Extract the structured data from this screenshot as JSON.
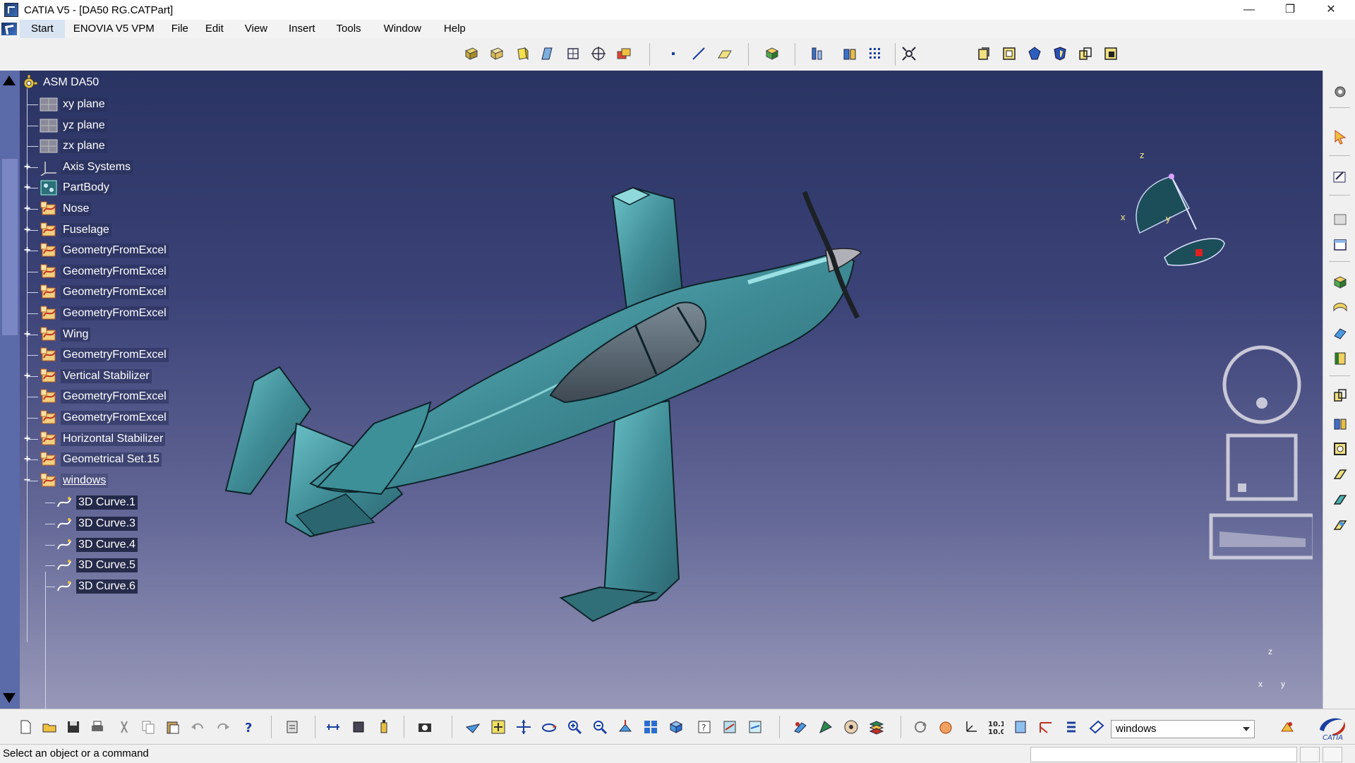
{
  "window": {
    "title": "CATIA V5 - [DA50 RG.CATPart]",
    "controls": [
      "—",
      "❐",
      "✕"
    ]
  },
  "menubar": {
    "items": [
      {
        "label": "Start",
        "name": "menu-start"
      },
      {
        "label": "ENOVIA V5 VPM",
        "name": "menu-enovia"
      },
      {
        "label": "File",
        "name": "menu-file"
      },
      {
        "label": "Edit",
        "name": "menu-edit"
      },
      {
        "label": "View",
        "name": "menu-view"
      },
      {
        "label": "Insert",
        "name": "menu-insert"
      },
      {
        "label": "Tools",
        "name": "menu-tools"
      },
      {
        "label": "Window",
        "name": "menu-window"
      },
      {
        "label": "Help",
        "name": "menu-help"
      }
    ],
    "doc_controls": [
      "_",
      "❐",
      "✕"
    ]
  },
  "tree": {
    "root": "ASM DA50",
    "nodes": [
      {
        "label": "xy plane",
        "icon": "plane-icon",
        "expandable": false
      },
      {
        "label": "yz plane",
        "icon": "plane-icon",
        "expandable": false
      },
      {
        "label": "zx plane",
        "icon": "plane-icon",
        "expandable": false
      },
      {
        "label": "Axis Systems",
        "icon": "axis-system-icon",
        "expandable": true
      },
      {
        "label": "PartBody",
        "icon": "partbody-icon",
        "expandable": true
      },
      {
        "label": "Nose",
        "icon": "geometrical-set-icon",
        "expandable": true
      },
      {
        "label": "Fuselage",
        "icon": "geometrical-set-icon",
        "expandable": true
      },
      {
        "label": "GeometryFromExcel",
        "icon": "geometrical-set-icon",
        "expandable": true
      },
      {
        "label": "GeometryFromExcel",
        "icon": "geometrical-set-icon",
        "expandable": false
      },
      {
        "label": "GeometryFromExcel",
        "icon": "geometrical-set-icon",
        "expandable": false
      },
      {
        "label": "GeometryFromExcel",
        "icon": "geometrical-set-icon",
        "expandable": false
      },
      {
        "label": "Wing",
        "icon": "geometrical-set-icon",
        "expandable": true
      },
      {
        "label": "GeometryFromExcel",
        "icon": "geometrical-set-icon",
        "expandable": false
      },
      {
        "label": "Vertical Stabilizer",
        "icon": "geometrical-set-icon",
        "expandable": true
      },
      {
        "label": "GeometryFromExcel",
        "icon": "geometrical-set-icon",
        "expandable": false
      },
      {
        "label": "GeometryFromExcel",
        "icon": "geometrical-set-icon",
        "expandable": false
      },
      {
        "label": "Horizontal Stabilizer",
        "icon": "geometrical-set-icon",
        "expandable": true
      },
      {
        "label": "Geometrical Set.15",
        "icon": "geometrical-set-icon",
        "expandable": true
      },
      {
        "label": "windows",
        "icon": "geometrical-set-icon",
        "expandable": true,
        "expanded": true,
        "selected": true
      }
    ],
    "children": [
      {
        "label": "3D Curve.1",
        "icon": "curve-icon"
      },
      {
        "label": "3D Curve.3",
        "icon": "curve-icon"
      },
      {
        "label": "3D Curve.4",
        "icon": "curve-icon"
      },
      {
        "label": "3D Curve.5",
        "icon": "curve-icon"
      },
      {
        "label": "3D Curve.6",
        "icon": "curve-icon"
      }
    ]
  },
  "compass": {
    "x_label": "x",
    "y_label": "y",
    "z_label": "z"
  },
  "mini_axis": {
    "x_label": "x",
    "y_label": "y",
    "z_label": "z"
  },
  "bottom_toolbar": {
    "current_set_value": "windows"
  },
  "status": {
    "message": "Select an object or a command"
  },
  "colors": {
    "viewport_top": "#2a3463",
    "viewport_bottom": "#9798b8",
    "model": "#3f8c96",
    "model_highlight": "#7fd0d6",
    "canopy": "#55606c"
  }
}
